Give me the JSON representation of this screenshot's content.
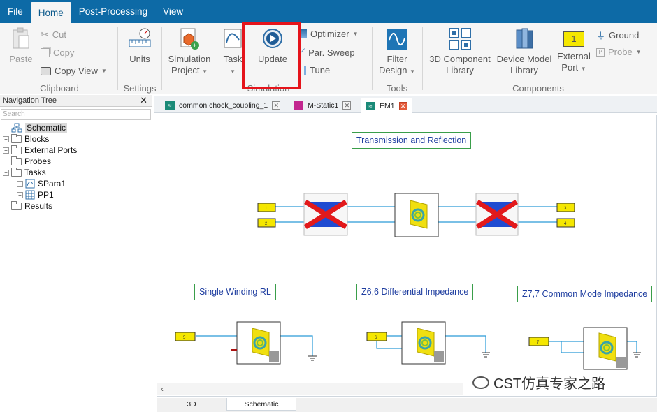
{
  "menu": {
    "tabs": [
      "File",
      "Home",
      "Post-Processing",
      "View"
    ]
  },
  "ribbon": {
    "clipboard": {
      "paste": "Paste",
      "cut": "Cut",
      "copy": "Copy",
      "copy_view": "Copy View",
      "label": "Clipboard"
    },
    "settings": {
      "units": "Units",
      "label": "Settings"
    },
    "simulation": {
      "sim_project_1": "Simulation",
      "sim_project_2": "Project",
      "task": "Task",
      "update": "Update",
      "optimizer": "Optimizer",
      "par_sweep": "Par. Sweep",
      "tune": "Tune",
      "label": "Simulation"
    },
    "tools": {
      "filter_1": "Filter",
      "filter_2": "Design",
      "label": "Tools"
    },
    "components": {
      "comp3d_1": "3D Component",
      "comp3d_2": "Library",
      "device_1": "Device Model",
      "device_2": "Library",
      "ext_1": "External",
      "ext_2": "Port",
      "ext_icon_label": "1",
      "ground": "Ground",
      "probe": "Probe",
      "label": "Components"
    }
  },
  "nav": {
    "title": "Navigation Tree",
    "search_placeholder": "Search",
    "items": [
      "Schematic",
      "Blocks",
      "External Ports",
      "Probes",
      "Tasks",
      "SPara1",
      "PP1",
      "Results"
    ]
  },
  "tabs": [
    "common chock_coupling_1",
    "M-Static1",
    "EM1"
  ],
  "canvas": {
    "labels": [
      "Transmission and Reflection",
      "Single Winding RL",
      "Z6,6 Differential Impedance",
      "Z7,7 Common Mode Impedance"
    ],
    "ports": [
      "1",
      "2",
      "3",
      "4",
      "5",
      "6",
      "7"
    ]
  },
  "bottom_tabs": [
    "3D",
    "Schematic"
  ],
  "watermark": "CST仿真专家之路",
  "colors": {
    "menubar": "#0d6aa6",
    "highlight": "#e5141b",
    "label_border": "#3a9e4a",
    "label_text": "#1f3ea0",
    "port_fill": "#f5e700",
    "wire": "#2a9bd8"
  }
}
